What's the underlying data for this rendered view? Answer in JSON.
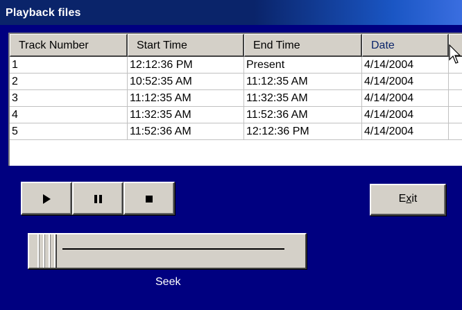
{
  "window": {
    "title": "Playback files"
  },
  "grid": {
    "columns": [
      "Track Number",
      "Start Time",
      "End Time",
      "Date"
    ],
    "rows": [
      [
        "1",
        "12:12:36 PM",
        "Present",
        "4/14/2004"
      ],
      [
        "2",
        "10:52:35 AM",
        "11:12:35 AM",
        "4/14/2004"
      ],
      [
        "3",
        "11:12:35 AM",
        "11:32:35 AM",
        "4/14/2004"
      ],
      [
        "4",
        "11:32:35 AM",
        "11:52:36 AM",
        "4/14/2004"
      ],
      [
        "5",
        "11:52:36 AM",
        "12:12:36 PM",
        "4/14/2004"
      ]
    ]
  },
  "controls": {
    "play_icon": "play-icon",
    "pause_icon": "pause-icon",
    "stop_icon": "stop-icon",
    "exit_label_prefix": "E",
    "exit_label_mnemonic": "x",
    "exit_label_suffix": "it"
  },
  "seek": {
    "label": "Seek",
    "position_fraction": 0.0
  },
  "colors": {
    "background": "#000080",
    "button_face": "#d4d0c8",
    "title_bar": "#0a246a"
  }
}
